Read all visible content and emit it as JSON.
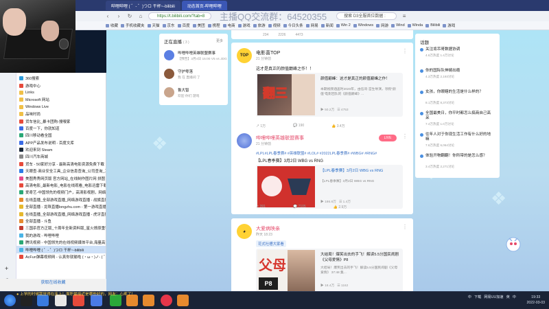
{
  "browser": {
    "tabs": [
      {
        "label": "哔哩哔哩 ( ゜- ゜)つロ 干杯~-bilibili",
        "active": false
      },
      {
        "label": "动态首页-哔哩哔哩",
        "active": true
      }
    ],
    "address": "https://t.bilibili.com/?tab=8",
    "overlay_text": "主播QQ交流群：64520355",
    "search_text": "搜索 D3全服首位数据 :",
    "bookmarks": [
      "收藏",
      "手机收藏夹",
      "天猫",
      "京东",
      "百度",
      "美团",
      "携程",
      "电商",
      "游戏",
      "旅游",
      "视频",
      "今日头条",
      "网易",
      "新闻",
      "Win 2",
      "Windows",
      "网游",
      "Wind",
      "Winda",
      "Bilibili",
      "游戏"
    ]
  },
  "sidebar": {
    "items": [
      {
        "label": "360搜索",
        "color": "#2d9cdb"
      },
      {
        "label": "游戏中心",
        "color": "#e64a3b"
      },
      {
        "label": "Links",
        "color": "#f0c048"
      },
      {
        "label": "Microsoft 网站",
        "color": "#f0c048"
      },
      {
        "label": "Windows Live",
        "color": "#f0c048"
      },
      {
        "label": "品味时尚",
        "color": "#f0c048"
      },
      {
        "label": "货车信比_暴卡团购-搜嗖家",
        "color": "#e64a3b"
      },
      {
        "label": "百度一下，你就知道",
        "color": "#3b6ce6"
      },
      {
        "label": "四川移动看全国",
        "color": "#2aa876"
      },
      {
        "label": "APP产品发布说明 - 百度文库",
        "color": "#3b6ce6"
      },
      {
        "label": "欢迎来到 Steam",
        "color": "#1b2838"
      },
      {
        "label": "四川汽车商城",
        "color": "#888888"
      },
      {
        "label": "货车 - 50家好分享 - 最新高清电影资源免费下载",
        "color": "#e64a3b"
      },
      {
        "label": "天眼查-商业安全工具_企业信息查询_公司查询_工商查询",
        "color": "#2d7ae6"
      },
      {
        "label": "美图秀秀网页版 官方网站_在线制作图片网 拼图 印...",
        "color": "#e64a8c"
      },
      {
        "label": "高清电影_最新电影_电影在线观看_电影迅雷下载...",
        "color": "#e64a3b"
      },
      {
        "label": "爱奇艺-中国领先的视频门户，高清影视剧，网络视频...",
        "color": "#2aa876"
      },
      {
        "label": "在线直播_全部游戏直播_网络游戏直播 - 战旗直播",
        "color": "#e68a2e"
      },
      {
        "label": "全部直播 - 龙珠直播longzhu.com - 第一游戏直播...",
        "color": "#e6b82e"
      },
      {
        "label": "在线直播_全部游戏直播_网络游戏直播 - 虎牙直播",
        "color": "#e6b82e"
      },
      {
        "label": "全部直播 - 斗鱼",
        "color": "#e68a2e"
      },
      {
        "label": "三国杀官方正版_十周年全新资料版_星火燎原重铸版",
        "color": "#c23b2e"
      },
      {
        "label": "我的游戏 - 哔哩哔哩",
        "color": "#4ab4e6"
      },
      {
        "label": "腾讯视频 - 中国领先的在线视频媒体平台,海量高清...",
        "color": "#2aa876"
      },
      {
        "label": "哔哩哔哩 ( ゜- ゜)つロ 干杯~-bilibili",
        "color": "#4ab4e6",
        "selected": true
      },
      {
        "label": "AcFun弹幕视频网 - 认真你就输啦 (・ω・)ノ- ( ゜- ゜)...",
        "color": "#e64a3b"
      }
    ],
    "footer": "获取在线收藏"
  },
  "live_panel": {
    "title": "正在直播",
    "count": "( 3 )",
    "more": "更多",
    "items": [
      {
        "name": "哔哩哔哩英雄联盟赛事",
        "sub": "【预告】3月4日 15:00 V5 vs JDG",
        "color": "#5b7fe3"
      },
      {
        "name": "守护零落",
        "sub": "我 在 直播间 了",
        "color": "#8b5a3c"
      },
      {
        "name": "鲁大智",
        "sub": "欢迎 你们 游戏",
        "color": "#c9a58c"
      }
    ]
  },
  "feed": {
    "top_stats": [
      "234",
      "2226",
      "4473"
    ],
    "posts": [
      {
        "author": "电影喜TOP",
        "time": "21 分钟前",
        "text": "这才是真正的颜值巅峰之作！！",
        "embed_title": "颜值巅峰：这才是真正的颜值巅峰之作！",
        "embed_desc": "本期视频涵盖时2020年，由伍哥·宫生导演，领衔“颜值”电影团队的《颜值巅峰》...",
        "embed_stats": [
          "50.2万",
          "4753"
        ],
        "thumb_text": "翻三",
        "actions": [
          "1万",
          "190",
          "3.4万"
        ]
      },
      {
        "author": "哔哩哔哩英雄联盟赛事",
        "time": "21 分钟前",
        "badge": "LIVE",
        "tags": "#LPL#LPL春季赛# #英雄联盟# #LOL# #2022LPL春季赛# #WBG# #RNG#",
        "text": "【LPL春季赛】3月2日 WBG vs RNG",
        "embed_title": "【LPL春季赛】3月2日 WBG vs RNG",
        "embed_desc": "【LPL春季赛】3月2日 WBG vs RNG",
        "embed_stats": [
          "186.8万",
          "1.4万"
        ],
        "actions": [
          "391",
          "7105",
          "2.9万"
        ]
      },
      {
        "author": "大爱病映亲",
        "time": "昨天 18:23",
        "tag": "花式吐槽大家看",
        "embed_title": "大结局！爆笑出去的手飞！解读5.5分国民闹剧《父母爱情》P8",
        "embed_desc": "大结局！爆笑出去的手飞！解读5.5分国民闹剧《父母爱情》 37:48 集...",
        "embed_stats": [
          "18.4万",
          "1162"
        ],
        "thumb_text": "父母",
        "thumb_label": "P8",
        "actions": [],
        "_note": ""
      }
    ]
  },
  "topics": {
    "title": "话题",
    "items": [
      {
        "title": "关注肯吊哥数据协调",
        "sub": "4.6万热度 1.4万讨论"
      },
      {
        "title": "你的国际队伸婉出瘾",
        "sub": "4.3万热度 2,193讨论"
      },
      {
        "title": "女孩，你眼瞎的生活是什么样的？",
        "sub": "8.1万热度 8,373讨论"
      },
      {
        "title": "全国最美日，你平时都怎么搞商自己高采",
        "sub": "7.4万热度 1.0万讨论"
      },
      {
        "title": "往年人对于你现生活工作有什么好的地嘛",
        "sub": "7.6万热度 6,064讨论"
      },
      {
        "title": "体验开物翻翻！你所带的是怎么感？",
        "sub": "3.4万热度 2,271讨论"
      }
    ]
  },
  "taskbar": {
    "ticker": "上学的时候我觉得在床上！面积最接近是哪些好的，网友：心疼了！",
    "tray": [
      "中",
      "下载",
      "网易UU加速",
      "英",
      "中"
    ],
    "time": "19:33",
    "date": "2022-03-03"
  }
}
